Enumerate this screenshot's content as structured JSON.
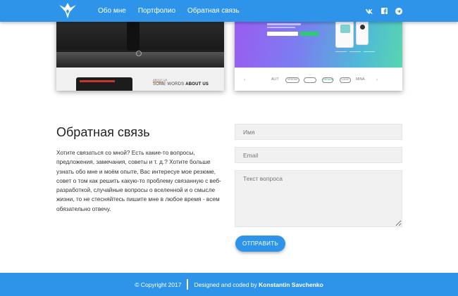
{
  "brand": {
    "logo_icon": "winged-bird-icon",
    "accent_color": "#2e94ea"
  },
  "nav": {
    "items": [
      {
        "label": "Обо мне"
      },
      {
        "label": "Портфолио"
      },
      {
        "label": "Обратная связь"
      }
    ]
  },
  "social": {
    "items": [
      {
        "icon": "vk-icon"
      },
      {
        "icon": "facebook-icon"
      },
      {
        "icon": "telegram-icon"
      }
    ]
  },
  "portfolio": {
    "card_1": {
      "about_small": "ABOUT US",
      "about_prefix": "SOME WORDS ",
      "about_bold": "ABOUT US"
    },
    "card_2": {
      "logos": [
        "ALIT",
        "VEROMI",
        "",
        "ORGANIC",
        "LOGIC",
        "MINA"
      ]
    }
  },
  "contact": {
    "title": "Обратная связь",
    "text": "Хотите связаться со мной? Есть какие-то вопросы, предложения, замечания, советы и т. д.? Хотите больше узнать обо мне и моём опыте, Вас интересуе мое резюме, совет о том как решить какую-то проблему связанную с веб-разработкой, случайные вопросы о вселенной и о смысле жизни, то не стесняйтесь пишите мне в любое время - всем обязательно отвечу.",
    "form": {
      "name_placeholder": "Имя",
      "email_placeholder": "Email",
      "question_placeholder": "Текст вопроса",
      "submit_label": "ОТПРАВИТЬ"
    }
  },
  "footer": {
    "copyright": "© Copyright 2017",
    "credit_prefix": "Designed and coded by ",
    "author": "Konstantin Savchenko"
  }
}
